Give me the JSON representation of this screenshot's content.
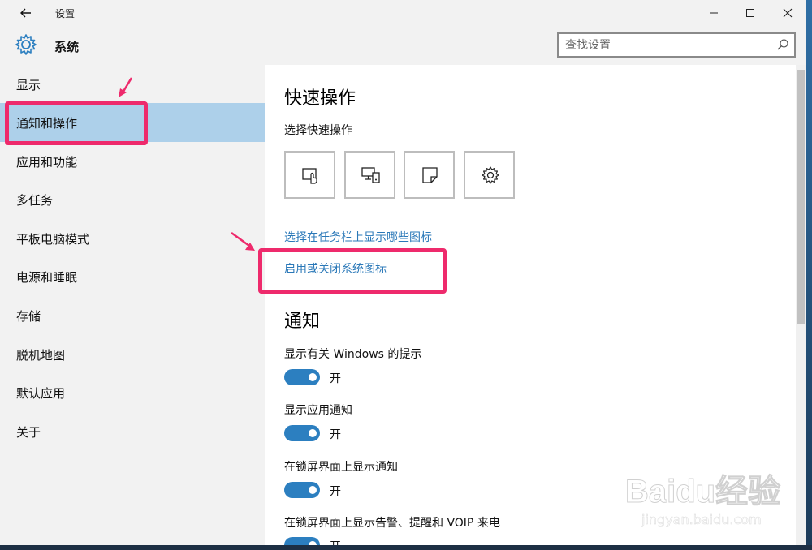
{
  "titlebar": {
    "back_icon": "arrow-left-icon",
    "title": "设置",
    "minimize_icon": "minimize-icon",
    "maximize_icon": "maximize-icon",
    "close_icon": "close-icon"
  },
  "header": {
    "logo_icon": "gear-icon",
    "section_title": "系统",
    "search_placeholder": "查找设置",
    "search_icon": "search-icon"
  },
  "sidebar": {
    "items": [
      {
        "label": "显示",
        "selected": false
      },
      {
        "label": "通知和操作",
        "selected": true
      },
      {
        "label": "应用和功能",
        "selected": false
      },
      {
        "label": "多任务",
        "selected": false
      },
      {
        "label": "平板电脑模式",
        "selected": false
      },
      {
        "label": "电源和睡眠",
        "selected": false
      },
      {
        "label": "存储",
        "selected": false
      },
      {
        "label": "脱机地图",
        "selected": false
      },
      {
        "label": "默认应用",
        "selected": false
      },
      {
        "label": "关于",
        "selected": false
      }
    ]
  },
  "main": {
    "quick_actions_heading": "快速操作",
    "quick_actions_label": "选择快速操作",
    "quick_action_icons": [
      "tablet-mode-icon",
      "connect-icon",
      "note-icon",
      "settings-gear-icon"
    ],
    "link_taskbar_icons": "选择在任务栏上显示哪些图标",
    "link_system_icons": "启用或关闭系统图标",
    "notifications_heading": "通知",
    "toggles": [
      {
        "label": "显示有关 Windows 的提示",
        "state": "开",
        "on": true
      },
      {
        "label": "显示应用通知",
        "state": "开",
        "on": true
      },
      {
        "label": "在锁屏界面上显示通知",
        "state": "开",
        "on": true
      },
      {
        "label": "在锁屏界面上显示告警、提醒和 VOIP 来电",
        "state": "开",
        "on": true
      }
    ]
  },
  "colors": {
    "accent": "#2c7fc0",
    "selected_nav": "#add0ea",
    "link": "#2a78b8",
    "annotation": "#ee2a6c"
  },
  "watermark": {
    "logo_text": "Baidu经验",
    "url": "jingyan.baidu.com"
  }
}
